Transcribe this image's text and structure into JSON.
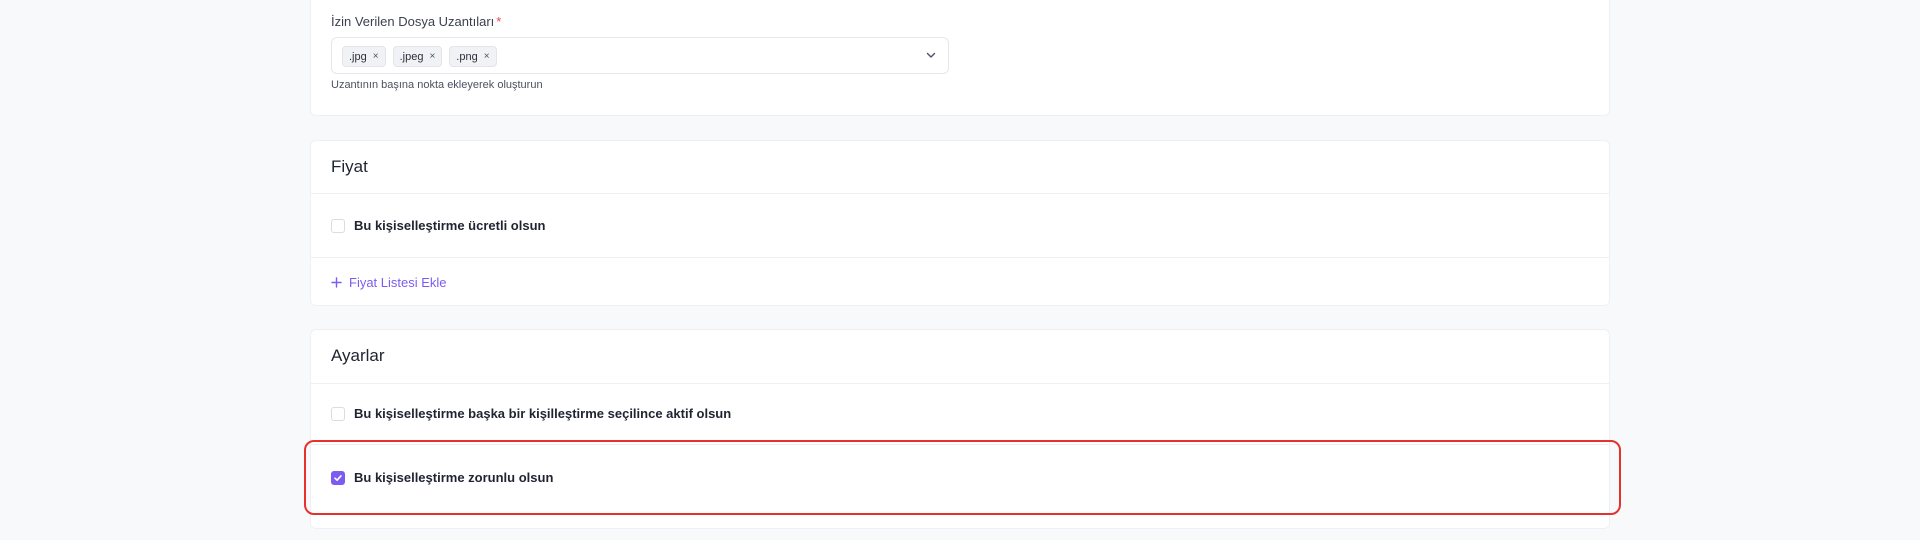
{
  "extensions": {
    "label": "İzin Verilen Dosya Uzantıları",
    "required_mark": "*",
    "tags": [
      ".jpg",
      ".jpeg",
      ".png"
    ],
    "remove_glyph": "×",
    "helper": "Uzantının başına nokta ekleyerek oluşturun"
  },
  "price": {
    "title": "Fiyat",
    "paid_checkbox": {
      "label": "Bu kişiselleştirme ücretli olsun",
      "checked": false
    },
    "add_price_list": "Fiyat Listesi Ekle"
  },
  "settings": {
    "title": "Ayarlar",
    "conditional_checkbox": {
      "label": "Bu kişiselleştirme başka bir kişilleştirme seçilince aktif olsun",
      "checked": false
    },
    "required_checkbox": {
      "label": "Bu kişiselleştirme zorunlu olsun",
      "checked": true
    }
  },
  "colors": {
    "accent": "#7c5cf0",
    "highlight": "#e5322d",
    "background": "#f8f9fb"
  },
  "icons": [
    "close-icon",
    "chevron-down-icon",
    "plus-icon",
    "check-icon"
  ]
}
